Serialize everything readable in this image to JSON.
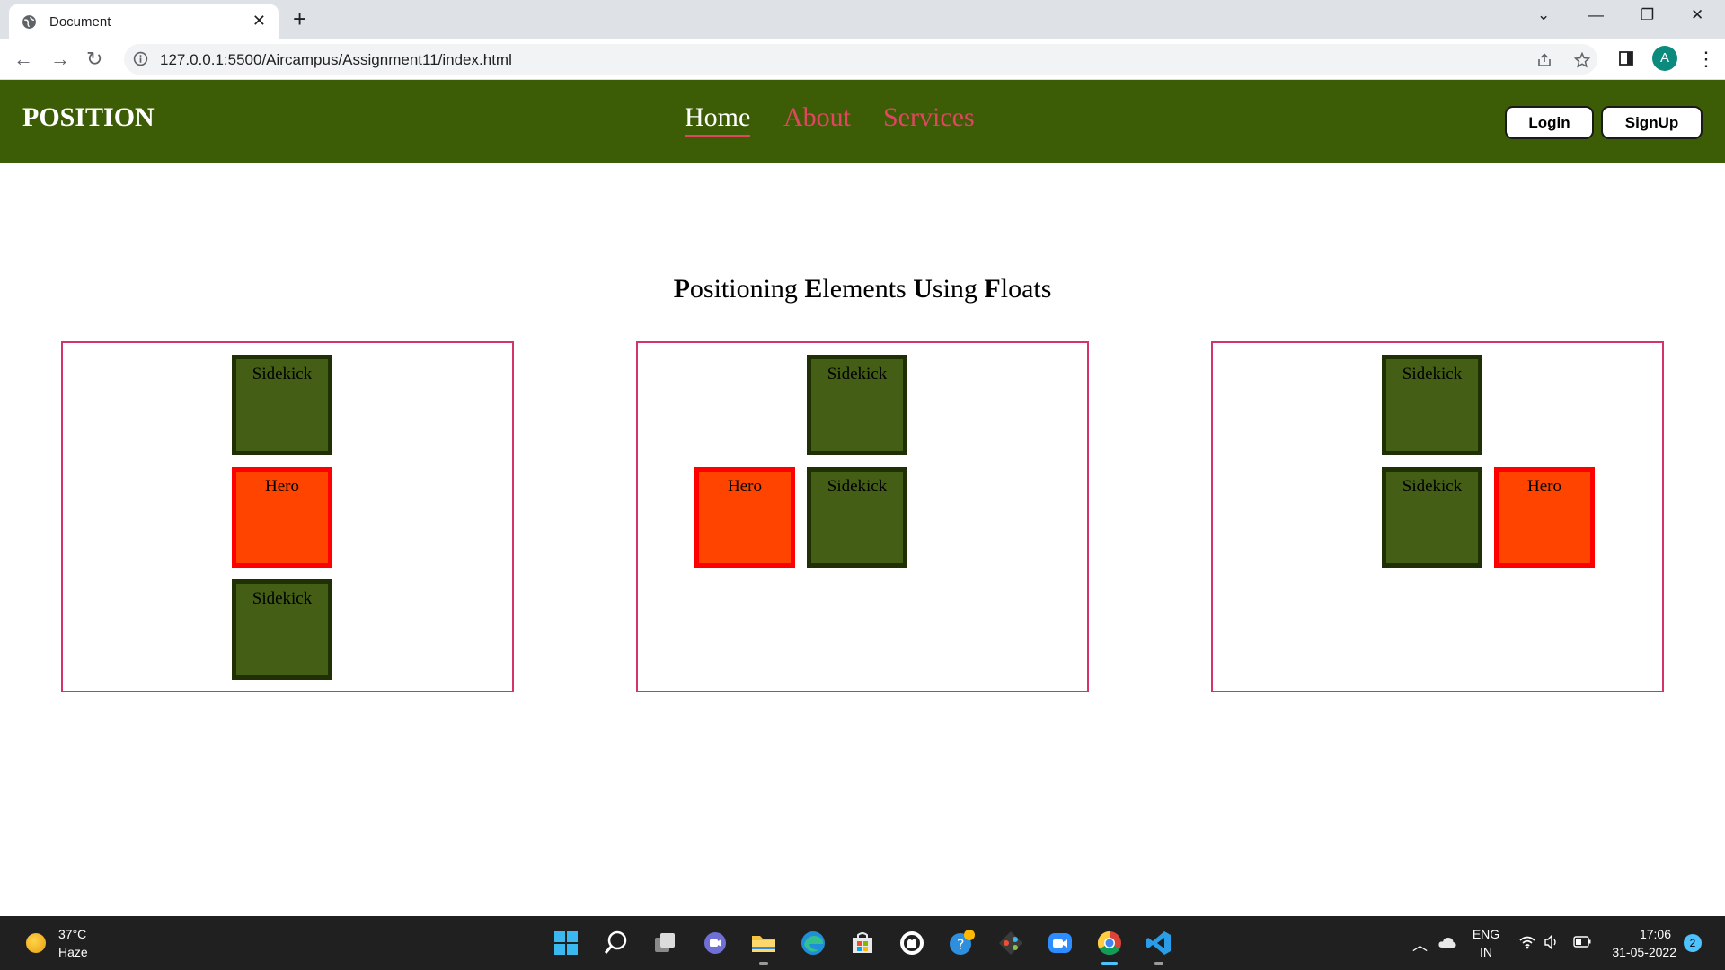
{
  "browser": {
    "tab_title": "Document",
    "url": "127.0.0.1:5500/Aircampus/Assignment11/index.html",
    "profile_initial": "A"
  },
  "site": {
    "logo": "POSITION",
    "nav": [
      "Home",
      "About",
      "Services"
    ],
    "login": "Login",
    "signup": "SignUp"
  },
  "title_parts": [
    {
      "b": "P",
      "t": "ositioning "
    },
    {
      "b": "E",
      "t": "lements "
    },
    {
      "b": "U",
      "t": "sing "
    },
    {
      "b": "F",
      "t": "loats"
    }
  ],
  "demos": [
    {
      "boxes": [
        "Sidekick",
        "Hero",
        "Sidekick"
      ]
    },
    {
      "boxes": [
        "Sidekick",
        "Hero",
        "Sidekick"
      ]
    },
    {
      "boxes": [
        "Sidekick",
        "Sidekick",
        "Hero"
      ]
    }
  ],
  "taskbar": {
    "temp": "37°C",
    "weather": "Haze",
    "lang_top": "ENG",
    "lang_bottom": "IN",
    "time": "17:06",
    "date": "31-05-2022",
    "notifications": "2"
  },
  "colors": {
    "nav_bg": "#3d5c06",
    "nav_link": "#e0475f",
    "sidekick": "#445e16",
    "hero": "#ff4400",
    "demo_border": "#d4346a"
  }
}
